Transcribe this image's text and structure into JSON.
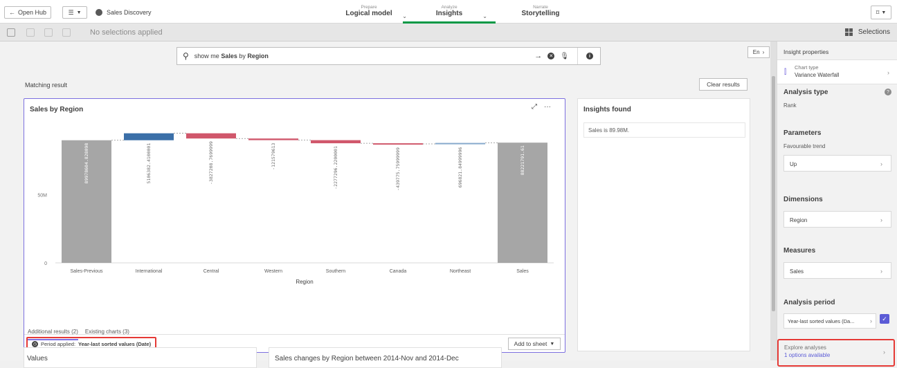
{
  "topbar": {
    "open_hub": "Open Hub",
    "app_name": "Sales Discovery",
    "tabs": [
      {
        "small": "Prepare",
        "big": "Logical model"
      },
      {
        "small": "Analyze",
        "big": "Insights"
      },
      {
        "small": "Narrate",
        "big": "Storytelling"
      }
    ]
  },
  "selection_bar": {
    "no_selections": "No selections applied",
    "selections_label": "Selections"
  },
  "search": {
    "prefix": "show me ",
    "bold1": "Sales",
    "mid": " by ",
    "bold2": "Region",
    "lang": "En"
  },
  "main": {
    "matching_result": "Matching result",
    "clear_results": "Clear results",
    "period_label": "Period applied:",
    "period_value": "Year-last sorted values (Date)",
    "add_to_sheet": "Add to sheet",
    "insights_title": "Insights found",
    "insight_item": "Sales is 89.98M.",
    "tabs": [
      "Additional results (2)",
      "Existing charts (3)"
    ],
    "lower_card_1": "Values",
    "lower_card_2": "Sales changes by Region between 2014-Nov and 2014-Dec"
  },
  "chart_data": {
    "type": "bar",
    "subtype": "waterfall",
    "title": "Sales by Region",
    "xlabel": "Region",
    "ylabel": "",
    "categories": [
      "Sales-Previous",
      "International",
      "Central",
      "Western",
      "Southern",
      "Canada",
      "Northeast",
      "Sales"
    ],
    "values": [
      89978604.828098,
      5106382.4100001,
      -3827208.7699999,
      -1215796.13,
      -2277296.2200001,
      -439775.75999999,
      696821.84999996,
      88221791.61
    ],
    "labels": [
      "89978604.828098",
      "5106382.4100001",
      "-3827208.7699999",
      "-121579613",
      "-2277296.2200001",
      "-439775.75999999",
      "696821.84999996",
      "88221791.61"
    ],
    "bar_colors": [
      "#a6a6a6",
      "#3b6fa8",
      "#d0576b",
      "#d0576b",
      "#d0576b",
      "#d0576b",
      "#86a9cc",
      "#a6a6a6"
    ],
    "ticks": [
      "0",
      "50M"
    ],
    "ylim": [
      0,
      100000000
    ],
    "grid": false
  },
  "sidebar": {
    "insight_properties": "Insight properties",
    "chart_type_label": "Chart type",
    "chart_type_value": "Variance Waterfall",
    "analysis_type": "Analysis type",
    "analysis_type_value": "Rank",
    "parameters": "Parameters",
    "favourable_trend": "Favourable trend",
    "favourable_value": "Up",
    "dimensions": "Dimensions",
    "dimension_value": "Region",
    "measures": "Measures",
    "measure_value": "Sales",
    "analysis_period": "Analysis period",
    "analysis_period_value": "Year-last sorted values (Da...",
    "explore_analyses": "Explore analyses",
    "options_available": "1 options available"
  }
}
